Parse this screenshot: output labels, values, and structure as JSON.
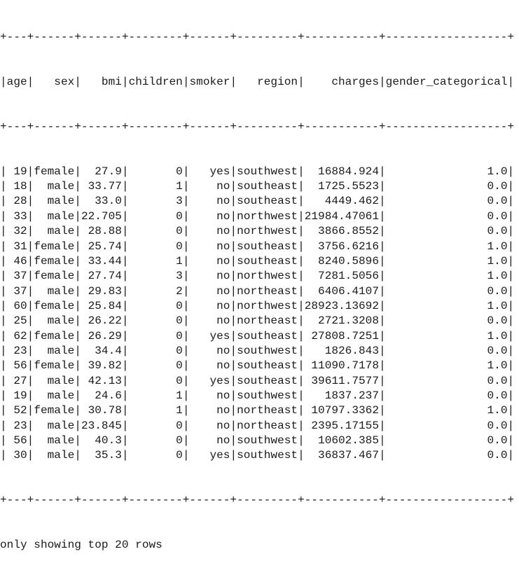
{
  "table": {
    "columns": [
      "age",
      "sex",
      "bmi",
      "children",
      "smoker",
      "region",
      "charges",
      "gender_categorical"
    ],
    "rows": [
      [
        "19",
        "female",
        "27.9",
        "0",
        "yes",
        "southwest",
        "16884.924",
        "1.0"
      ],
      [
        "18",
        "male",
        "33.77",
        "1",
        "no",
        "southeast",
        "1725.5523",
        "0.0"
      ],
      [
        "28",
        "male",
        "33.0",
        "3",
        "no",
        "southeast",
        "4449.462",
        "0.0"
      ],
      [
        "33",
        "male",
        "22.705",
        "0",
        "no",
        "northwest",
        "21984.47061",
        "0.0"
      ],
      [
        "32",
        "male",
        "28.88",
        "0",
        "no",
        "northwest",
        "3866.8552",
        "0.0"
      ],
      [
        "31",
        "female",
        "25.74",
        "0",
        "no",
        "southeast",
        "3756.6216",
        "1.0"
      ],
      [
        "46",
        "female",
        "33.44",
        "1",
        "no",
        "southeast",
        "8240.5896",
        "1.0"
      ],
      [
        "37",
        "female",
        "27.74",
        "3",
        "no",
        "northwest",
        "7281.5056",
        "1.0"
      ],
      [
        "37",
        "male",
        "29.83",
        "2",
        "no",
        "northeast",
        "6406.4107",
        "0.0"
      ],
      [
        "60",
        "female",
        "25.84",
        "0",
        "no",
        "northwest",
        "28923.13692",
        "1.0"
      ],
      [
        "25",
        "male",
        "26.22",
        "0",
        "no",
        "northeast",
        "2721.3208",
        "0.0"
      ],
      [
        "62",
        "female",
        "26.29",
        "0",
        "yes",
        "southeast",
        "27808.7251",
        "1.0"
      ],
      [
        "23",
        "male",
        "34.4",
        "0",
        "no",
        "southwest",
        "1826.843",
        "0.0"
      ],
      [
        "56",
        "female",
        "39.82",
        "0",
        "no",
        "southeast",
        "11090.7178",
        "1.0"
      ],
      [
        "27",
        "male",
        "42.13",
        "0",
        "yes",
        "southeast",
        "39611.7577",
        "0.0"
      ],
      [
        "19",
        "male",
        "24.6",
        "1",
        "no",
        "southwest",
        "1837.237",
        "0.0"
      ],
      [
        "52",
        "female",
        "30.78",
        "1",
        "no",
        "northeast",
        "10797.3362",
        "1.0"
      ],
      [
        "23",
        "male",
        "23.845",
        "0",
        "no",
        "northeast",
        "2395.17155",
        "0.0"
      ],
      [
        "56",
        "male",
        "40.3",
        "0",
        "no",
        "southwest",
        "10602.385",
        "0.0"
      ],
      [
        "30",
        "male",
        "35.3",
        "0",
        "yes",
        "southwest",
        "36837.467",
        "0.0"
      ]
    ]
  },
  "footer": "only showing top 20 rows"
}
